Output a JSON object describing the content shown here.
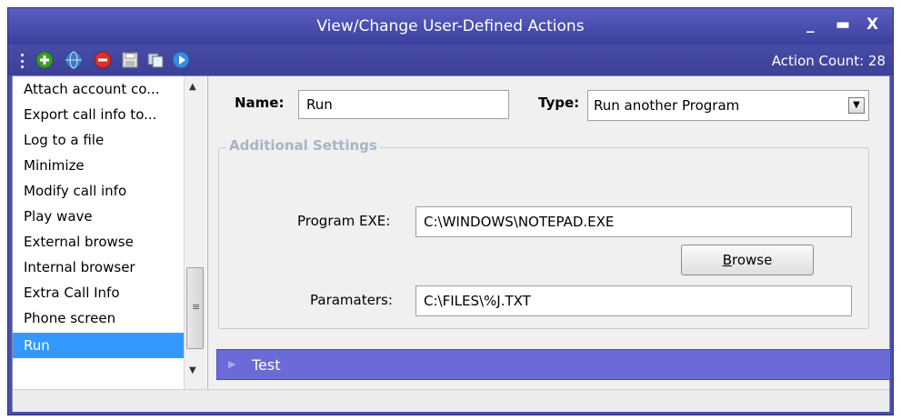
{
  "window": {
    "title": "View/Change User-Defined Actions",
    "minimize_glyph": "_",
    "maximize_glyph": "▬",
    "close_glyph": "X"
  },
  "toolbar": {
    "buttons": [
      {
        "icon": "add-icon",
        "color": "#3a9a2a"
      },
      {
        "icon": "globe-icon",
        "color": "#3a7ac8"
      },
      {
        "icon": "delete-icon",
        "color": "#d83030"
      },
      {
        "icon": "save-icon",
        "color": "#e0e0e0"
      },
      {
        "icon": "copy-icon",
        "color": "#c8d8e8"
      },
      {
        "icon": "play-icon",
        "color": "#3a8ae0"
      }
    ],
    "action_count": "Action Count: 28"
  },
  "actions_list": {
    "items": [
      "Attach account co...",
      "Export call info to...",
      "Log to a file",
      "Minimize",
      "Modify call info",
      "Play wave",
      "External browse",
      "Internal browser",
      "Extra Call Info",
      "Phone screen",
      "Run"
    ],
    "selected": "Run"
  },
  "form": {
    "name_label": "Name:",
    "name_value": "Run",
    "type_label": "Type:",
    "type_value": "Run another Program",
    "group_title": "Additional Settings",
    "program_exe_label": "Program EXE:",
    "program_exe_value": "C:\\WINDOWS\\NOTEPAD.EXE",
    "browse_accel": "B",
    "browse_rest": "rowse",
    "parameters_label": "Paramaters:",
    "parameters_value": "C:\\FILES\\%J.TXT"
  },
  "test_bar": {
    "label": "Test"
  }
}
